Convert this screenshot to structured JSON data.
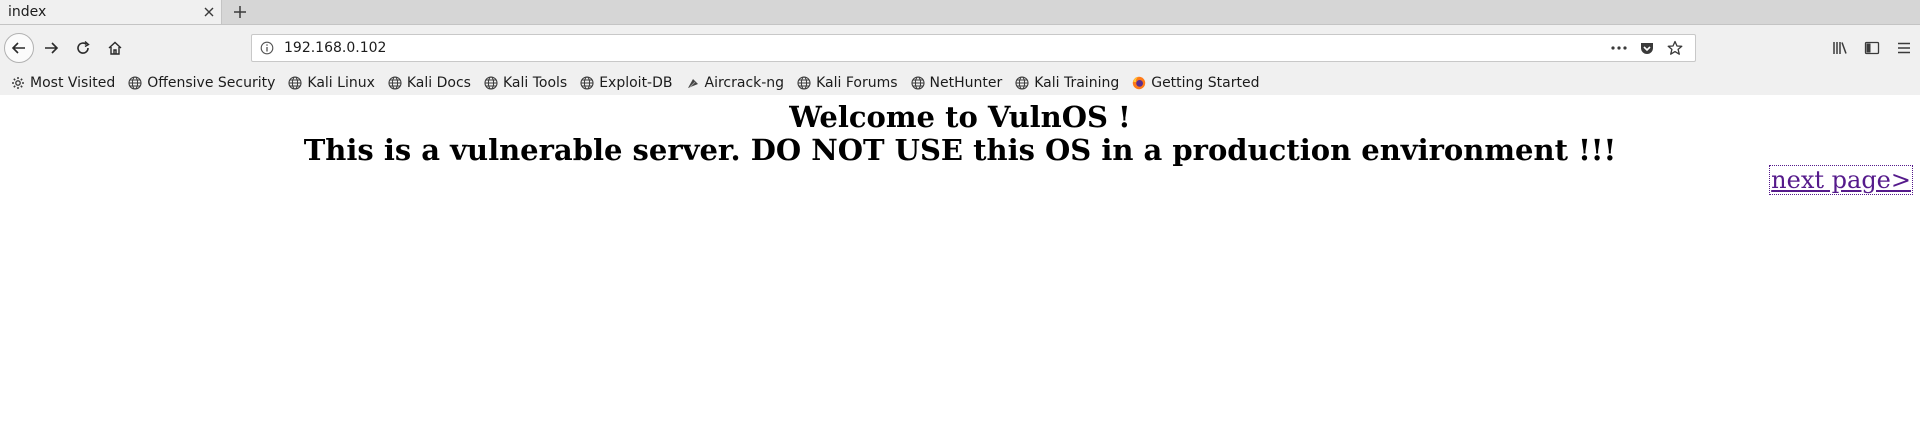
{
  "tab": {
    "title": "index"
  },
  "urlbar": {
    "url": "192.168.0.102"
  },
  "bookmarks": [
    {
      "label": "Most Visited",
      "icon": "gear-icon"
    },
    {
      "label": "Offensive Security",
      "icon": "globe-icon"
    },
    {
      "label": "Kali Linux",
      "icon": "globe-icon"
    },
    {
      "label": "Kali Docs",
      "icon": "globe-icon"
    },
    {
      "label": "Kali Tools",
      "icon": "globe-icon"
    },
    {
      "label": "Exploit-DB",
      "icon": "globe-icon"
    },
    {
      "label": "Aircrack-ng",
      "icon": "aircrack-icon"
    },
    {
      "label": "Kali Forums",
      "icon": "globe-icon"
    },
    {
      "label": "NetHunter",
      "icon": "globe-icon"
    },
    {
      "label": "Kali Training",
      "icon": "globe-icon"
    },
    {
      "label": "Getting Started",
      "icon": "firefox-icon"
    }
  ],
  "page": {
    "heading_line1": "Welcome to VulnOS !",
    "heading_line2": "This is a vulnerable server. DO NOT USE this OS in a production environment !!!",
    "next_link": "next page>"
  },
  "colors": {
    "link": "#551a8b",
    "chrome": "#f0f0f0",
    "tabstrip": "#d6d6d6"
  }
}
